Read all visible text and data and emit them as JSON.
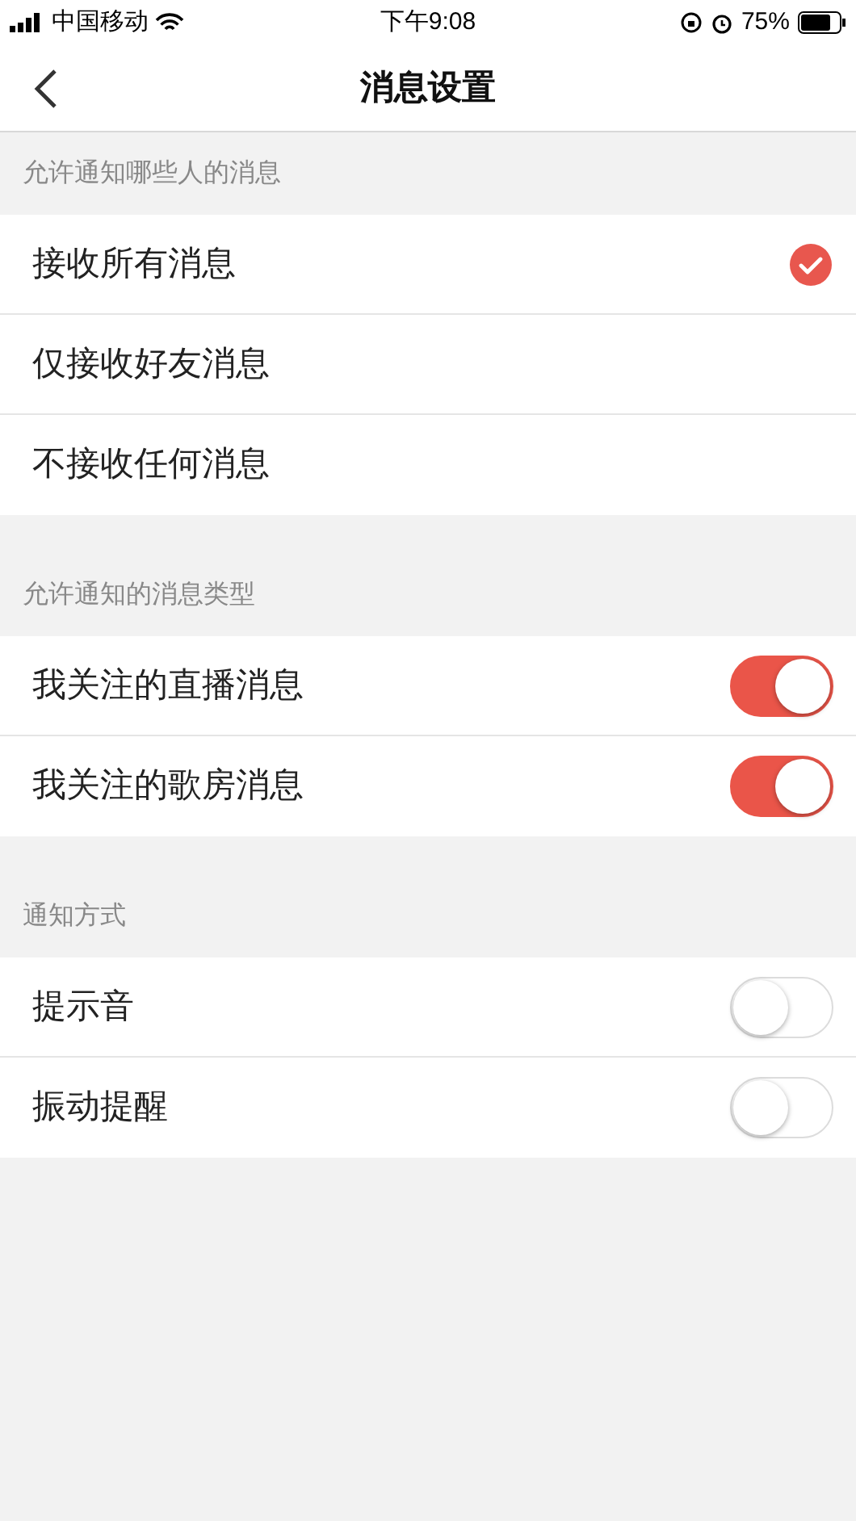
{
  "status_bar": {
    "carrier": "中国移动",
    "time": "下午9:08",
    "battery": "75%"
  },
  "nav": {
    "title": "消息设置"
  },
  "sections": [
    {
      "header": "允许通知哪些人的消息",
      "rows": [
        {
          "label": "接收所有消息",
          "kind": "radio",
          "selected": true
        },
        {
          "label": "仅接收好友消息",
          "kind": "radio",
          "selected": false
        },
        {
          "label": "不接收任何消息",
          "kind": "radio",
          "selected": false
        }
      ]
    },
    {
      "header": "允许通知的消息类型",
      "rows": [
        {
          "label": "我关注的直播消息",
          "kind": "toggle",
          "on": true
        },
        {
          "label": "我关注的歌房消息",
          "kind": "toggle",
          "on": true
        }
      ]
    },
    {
      "header": "通知方式",
      "rows": [
        {
          "label": "提示音",
          "kind": "toggle",
          "on": false
        },
        {
          "label": "振动提醒",
          "kind": "toggle",
          "on": false
        }
      ]
    }
  ]
}
